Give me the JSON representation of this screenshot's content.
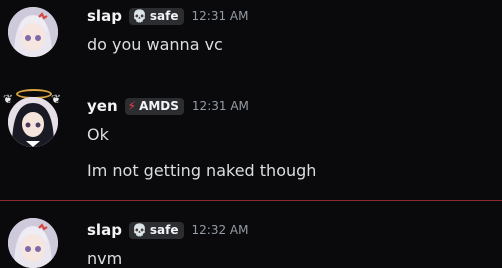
{
  "messages": [
    {
      "username": "slap",
      "tag": {
        "icon": "skull-icon",
        "label": "safe"
      },
      "timestamp": "12:31 AM",
      "lines": [
        "do you wanna vc"
      ]
    },
    {
      "username": "yen",
      "tag": {
        "icon": "lightning-icon",
        "label": "AMDS"
      },
      "timestamp": "12:31 AM",
      "lines": [
        "Ok",
        "Im not getting naked though"
      ]
    },
    {
      "username": "slap",
      "tag": {
        "icon": "skull-icon",
        "label": "safe"
      },
      "timestamp": "12:32 AM",
      "lines": [
        "nvm"
      ]
    }
  ],
  "colors": {
    "background": "#0a0a0c",
    "username": "#f2f3f5",
    "timestamp": "#949ba4",
    "text": "#dbdee1",
    "new_divider": "#8a2b33",
    "lightning": "#e8413c"
  }
}
